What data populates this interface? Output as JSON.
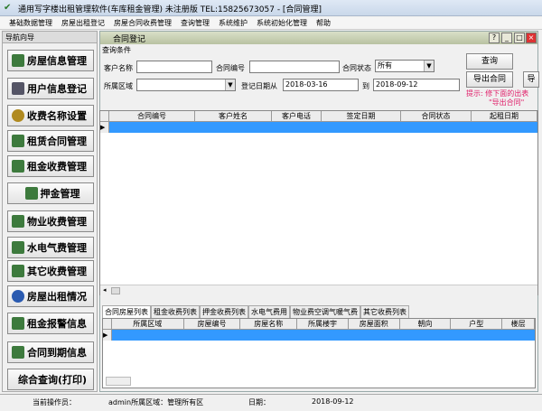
{
  "title": "通用写字楼出租管理软件(车库租金管理) 未注册版 TEL:15825673057 - [合同管理]",
  "menu": [
    "基础数据管理",
    "房屋出租登记",
    "房屋合同收费管理",
    "查询管理",
    "系统维护",
    "系统初始化管理",
    "帮助"
  ],
  "nav": {
    "header": "导航向导",
    "items": [
      "房屋信息管理",
      "用户信息登记",
      "收费名称设置",
      "租赁合同管理",
      "租金收费管理",
      "押金管理",
      "物业收费管理",
      "水电气费管理",
      "其它收费管理",
      "房屋出租情况",
      "租金报警信息",
      "合同到期信息",
      "综合查询(打印)"
    ]
  },
  "window": {
    "title": "合同登记"
  },
  "query": {
    "group": "查询条件",
    "customer_label": "客户名称",
    "customer_value": "",
    "contract_no_label": "合同编号",
    "contract_no_value": "",
    "status_label": "合同状态",
    "status_value": "所有",
    "region_label": "所属区域",
    "region_value": "",
    "date_from_label": "登记日期从",
    "date_from": "2018-03-16",
    "date_to_label": "到",
    "date_to": "2018-09-12",
    "search_btn": "查询",
    "export_btn": "导出合同",
    "export2_btn": "导",
    "hint1": "提示: 修下面的出表",
    "hint2": "\"导出合同\""
  },
  "grid1": {
    "columns": [
      "合同编号",
      "客户姓名",
      "客户电话",
      "签定日期",
      "合同状态",
      "起租日期"
    ]
  },
  "tabs": [
    "合同房屋列表",
    "租金收费列表",
    "押金收费列表",
    "水电气费用",
    "物业费空调气暖气费",
    "其它收费列表"
  ],
  "grid2": {
    "columns": [
      "所属区域",
      "房屋编号",
      "房屋名称",
      "所属楼宇",
      "房屋面积",
      "朝向",
      "户型",
      "楼层"
    ]
  },
  "status": {
    "operator_label": "当前操作员：",
    "operator_value": "admin所属区域：管理所有区",
    "date_label": "日期：",
    "date_value": "2018-09-12"
  }
}
